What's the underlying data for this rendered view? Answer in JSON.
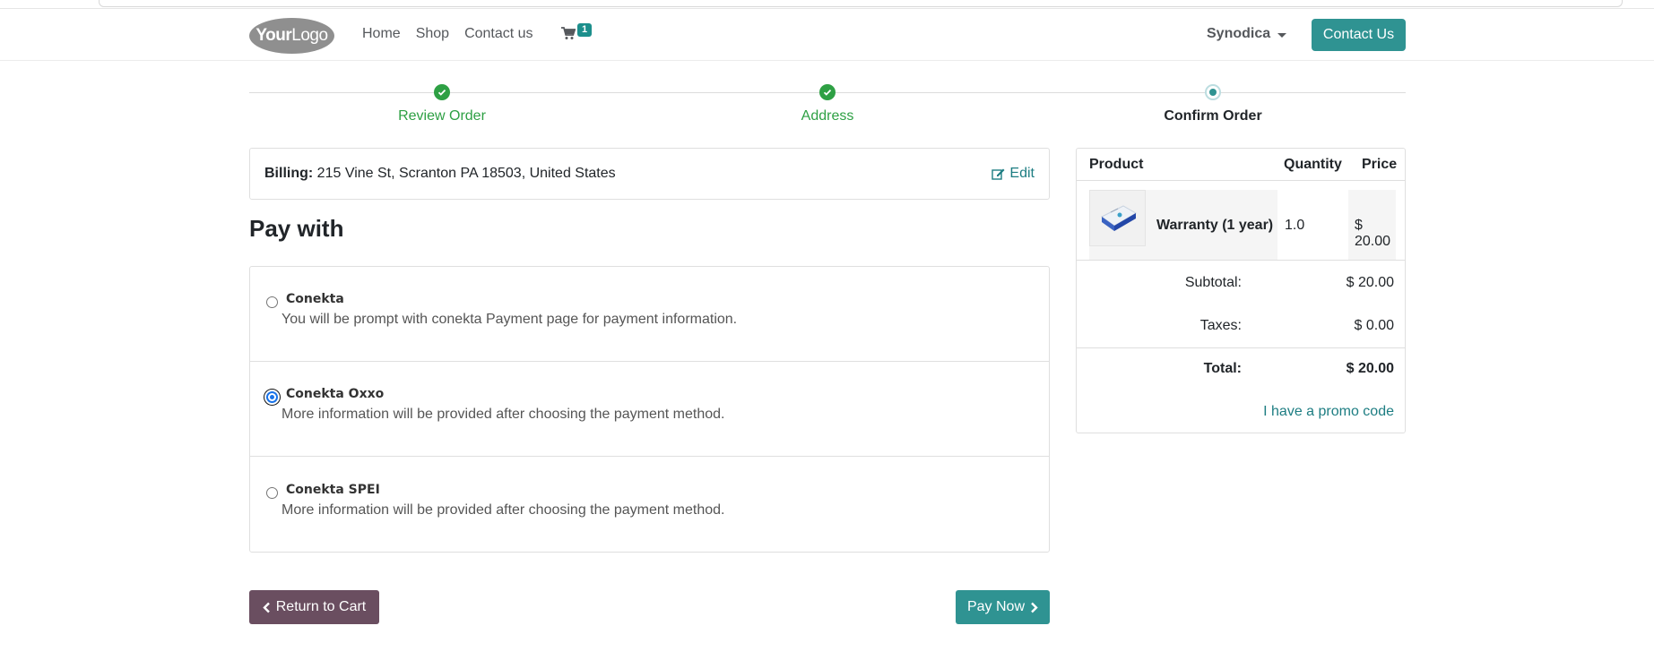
{
  "header": {
    "logo": {
      "bold": "Your",
      "light": "Logo"
    },
    "nav": [
      "Home",
      "Shop",
      "Contact us"
    ],
    "cart_count": "1",
    "user": "Synodica",
    "contact_button": "Contact Us"
  },
  "steps": [
    {
      "label": "Review Order",
      "state": "done"
    },
    {
      "label": "Address",
      "state": "done"
    },
    {
      "label": "Confirm Order",
      "state": "current"
    }
  ],
  "billing": {
    "label": "Billing:",
    "address": "215 Vine St, Scranton PA 18503, United States",
    "edit": "Edit"
  },
  "pay": {
    "title": "Pay with",
    "options": [
      {
        "name": "Conekta",
        "desc": "You will be prompt with conekta Payment page for payment information.",
        "selected": false
      },
      {
        "name": "Conekta Oxxo",
        "desc": "More information will be provided after choosing the payment method.",
        "selected": true
      },
      {
        "name": "Conekta SPEI",
        "desc": "More information will be provided after choosing the payment method.",
        "selected": false
      }
    ],
    "return_button": "Return to Cart",
    "pay_button": "Pay Now"
  },
  "summary": {
    "headers": {
      "product": "Product",
      "quantity": "Quantity",
      "price": "Price"
    },
    "item": {
      "name": "Warranty (1 year)",
      "quantity": "1.0",
      "price": "$ 20.00"
    },
    "subtotal_label": "Subtotal:",
    "subtotal": "$ 20.00",
    "taxes_label": "Taxes:",
    "taxes": "$ 0.00",
    "total_label": "Total:",
    "total": "$ 20.00",
    "promo": "I have a promo code"
  },
  "colors": {
    "primary": "#2f9392",
    "secondary": "#6a4e60",
    "success": "#2ea044",
    "link": "#1d7d82"
  }
}
